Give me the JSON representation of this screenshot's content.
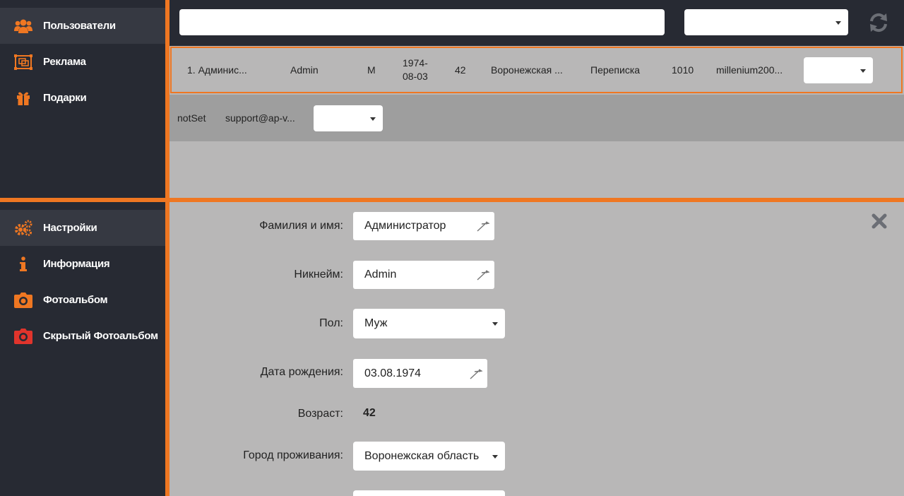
{
  "sidebar_top": {
    "items": [
      {
        "label": "Пользователи",
        "icon": "users-icon"
      },
      {
        "label": "Реклама",
        "icon": "ads-icon"
      },
      {
        "label": "Подарки",
        "icon": "gift-icon"
      }
    ]
  },
  "sidebar_bottom": {
    "items": [
      {
        "label": "Настройки",
        "icon": "gears-icon"
      },
      {
        "label": "Информация",
        "icon": "info-icon"
      },
      {
        "label": "Фотоальбом",
        "icon": "camera-icon"
      },
      {
        "label": "Скрытый Фотоальбом",
        "icon": "hidden-camera-icon"
      }
    ]
  },
  "search": {
    "value": "",
    "placeholder": ""
  },
  "user_row": {
    "name": "1. Админис...",
    "nickname": "Admin",
    "gender": "М",
    "birth_line1": "1974-",
    "birth_line2": "08-03",
    "age": "42",
    "region": "Воронежская ...",
    "status": "Переписка",
    "id": "1010",
    "login": "millenium200..."
  },
  "sub_row": {
    "state": "notSet",
    "email": "support@ap-v..."
  },
  "form": {
    "fullname_label": "Фамилия и имя:",
    "fullname_value": "Администратор",
    "nickname_label": "Никнейм:",
    "nickname_value": "Admin",
    "gender_label": "Пол:",
    "gender_value": "Муж",
    "birthdate_label": "Дата рождения:",
    "birthdate_value": "03.08.1974",
    "age_label": "Возраст:",
    "age_value": "42",
    "city_label": "Город проживания:",
    "city_value": "Воронежская область"
  },
  "colors": {
    "accent": "#ef7722",
    "sidebar": "#272a33",
    "content": "#b8b7b7",
    "hidden_camera": "#e0342c"
  }
}
